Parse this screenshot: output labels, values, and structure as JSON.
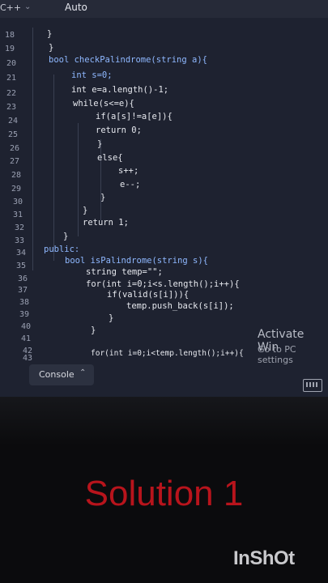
{
  "toolbar": {
    "language": "C++",
    "mode": "Auto"
  },
  "editor": {
    "lines": [
      {
        "num": "18",
        "code": "}"
      },
      {
        "num": "19",
        "code": "}"
      },
      {
        "num": "20",
        "code": "bool checkPalindrome(string a){"
      },
      {
        "num": "21",
        "code": "int s=0;"
      },
      {
        "num": "22",
        "code": "int e=a.length()-1;"
      },
      {
        "num": "23",
        "code": "while(s<=e){"
      },
      {
        "num": "24",
        "code": "if(a[s]!=a[e]){"
      },
      {
        "num": "25",
        "code": "return 0;"
      },
      {
        "num": "26",
        "code": "}"
      },
      {
        "num": "27",
        "code": "else{"
      },
      {
        "num": "28",
        "code": "s++;"
      },
      {
        "num": "29",
        "code": "e--;"
      },
      {
        "num": "30",
        "code": "}"
      },
      {
        "num": "31",
        "code": "}"
      },
      {
        "num": "32",
        "code": "return 1;"
      },
      {
        "num": "33",
        "code": "}"
      },
      {
        "num": "34",
        "code": "public:"
      },
      {
        "num": "35",
        "code": "bool isPalindrome(string s){"
      },
      {
        "num": "36",
        "code": "string temp=\"\";"
      },
      {
        "num": "37",
        "code": "for(int i=0;i<s.length();i++){"
      },
      {
        "num": "38",
        "code": "if(valid(s[i])){"
      },
      {
        "num": "39",
        "code": "temp.push_back(s[i]);"
      },
      {
        "num": "40",
        "code": "}"
      },
      {
        "num": "41",
        "code": "}"
      },
      {
        "num": "42",
        "code": ""
      },
      {
        "num": "43",
        "code": "for(int i=0;i<temp.length();i++){"
      }
    ]
  },
  "watermark": {
    "title": "Activate Win",
    "subtitle": "Go to PC settings"
  },
  "console": {
    "label": "Console"
  },
  "overlay": {
    "caption": "Solution 1",
    "brand": "InShOt"
  },
  "colors": {
    "caption": "#b8141c",
    "keyword": "#8fb8ff",
    "editor_bg": "#1e2230"
  }
}
